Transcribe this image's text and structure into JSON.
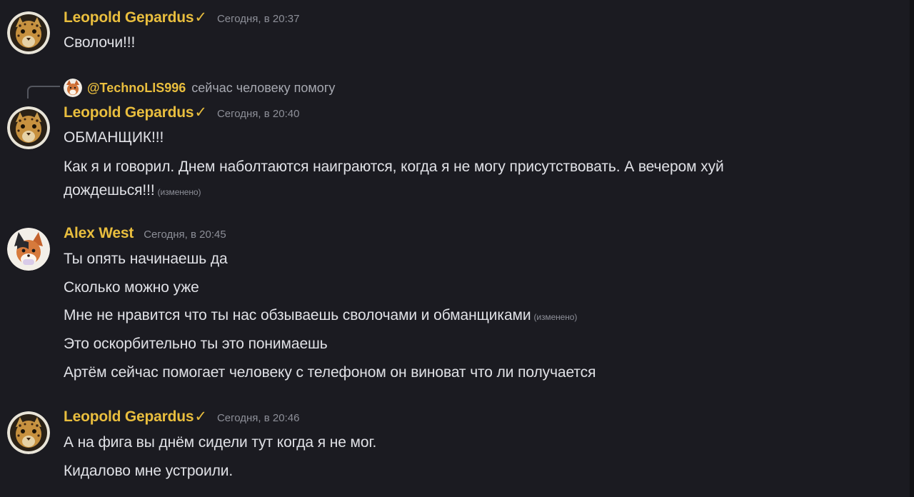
{
  "messages": [
    {
      "author": "Leopold Gepardus",
      "verified_mark": "✓",
      "time": "Сегодня, в 20:37",
      "lines": [
        {
          "text": "Сволочи!!!"
        }
      ]
    },
    {
      "reply": {
        "mention": "@TechnoLIS996",
        "text": "сейчас человеку помогу"
      },
      "author": "Leopold Gepardus",
      "verified_mark": "✓",
      "time": "Сегодня, в 20:40",
      "lines": [
        {
          "text": "ОБМАНЩИК!!!"
        },
        {
          "text": "Как я и говорил. Днем наболтаются наиграются, когда я не могу присутствовать. А вечером хуй"
        },
        {
          "text": "дождешься!!!",
          "edited": "(изменено)"
        }
      ]
    },
    {
      "author": "Alex West",
      "time": "Сегодня, в 20:45",
      "lines": [
        {
          "text": "Ты опять начинаешь да"
        },
        {
          "text": "Сколько можно уже"
        },
        {
          "text": "Мне не нравится что ты нас обзываешь сволочами и обманщиками",
          "edited": "(изменено)"
        },
        {
          "text": "Это оскорбительно ты это понимаешь"
        },
        {
          "text": "Артём сейчас помогает человеку с телефоном он виноват что ли получается"
        }
      ]
    },
    {
      "author": "Leopold Gepardus",
      "verified_mark": "✓",
      "time": "Сегодня, в 20:46",
      "lines": [
        {
          "text": "А на фига вы днём сидели тут когда я не мог."
        },
        {
          "text": "Кидалово мне устроили."
        }
      ]
    }
  ],
  "icons": {
    "leopold_avatar": "leopard-avatar-icon",
    "alex_avatar": "fox-avatar-icon",
    "reply_avatar": "fox-avatar-icon",
    "verified": "checkmark-icon"
  },
  "colors": {
    "background": "#1b1b21",
    "username": "#e9be3e",
    "text": "#e0e1e6",
    "muted": "#8d8f98"
  }
}
